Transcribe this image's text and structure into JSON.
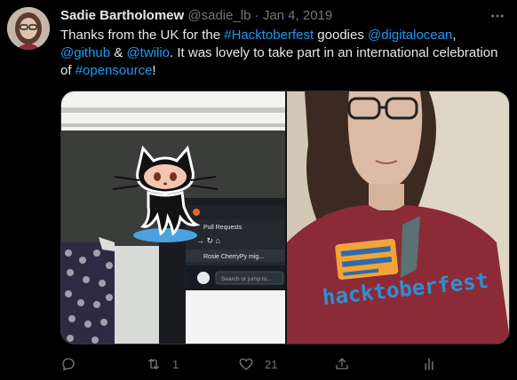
{
  "tweet": {
    "display_name": "Sadie Bartholomew",
    "handle": "@sadie_lb",
    "separator": "·",
    "date": "Jan 4, 2019",
    "text_parts": [
      {
        "text": "Thanks from the UK for the ",
        "link": false
      },
      {
        "text": "#Hacktoberfest",
        "link": true
      },
      {
        "text": " goodies ",
        "link": false
      },
      {
        "text": "@digitalocean",
        "link": true
      },
      {
        "text": ", ",
        "link": false
      },
      {
        "text": "@github",
        "link": true
      },
      {
        "text": " & ",
        "link": false
      },
      {
        "text": "@twilio",
        "link": true
      },
      {
        "text": ". It was lovely to take part in an international celebration of ",
        "link": false
      },
      {
        "text": "#opensource",
        "link": true
      },
      {
        "text": "!",
        "link": false
      }
    ],
    "more_icon": "more-horizontal-icon"
  },
  "media": {
    "left_photo": {
      "browser_tab": "Pull Requests",
      "browser_item": "Rosie CherryPy mig...",
      "search_placeholder": "Search or jump to..."
    },
    "right_photo": {
      "shirt_text": "hacktoberfest"
    }
  },
  "actions": {
    "reply": {
      "icon": "reply-icon",
      "count": ""
    },
    "retweet": {
      "icon": "retweet-icon",
      "count": "1"
    },
    "like": {
      "icon": "heart-icon",
      "count": "21"
    },
    "share": {
      "icon": "share-icon",
      "count": ""
    },
    "analytics": {
      "icon": "analytics-icon",
      "count": ""
    }
  },
  "colors": {
    "background": "#000000",
    "text": "#e7e9ea",
    "muted": "#71767b",
    "link": "#1d9bf0",
    "shirt": "#8b2b38"
  }
}
